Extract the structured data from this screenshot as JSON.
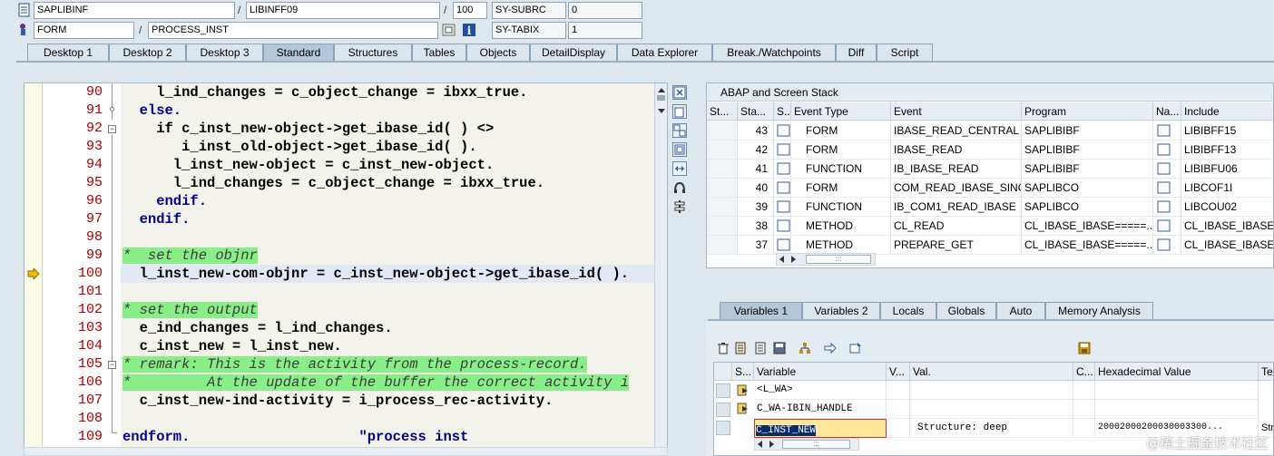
{
  "header": {
    "row1": {
      "program": "SAPLIBINF",
      "include": "LIBINFF09",
      "line": "100",
      "sysfield_name": "SY-SUBRC",
      "sysfield_value": "0"
    },
    "row2": {
      "event_type": "FORM",
      "event_name": "PROCESS_INST",
      "sysfield_name": "SY-TABIX",
      "sysfield_value": "1"
    }
  },
  "tabs": [
    "Desktop 1",
    "Desktop 2",
    "Desktop 3",
    "Standard",
    "Structures",
    "Tables",
    "Objects",
    "DetailDisplay",
    "Data Explorer",
    "Break./Watchpoints",
    "Diff",
    "Script"
  ],
  "active_tab": "Standard",
  "code": {
    "lines": [
      {
        "num": "90",
        "text": "    l_ind_changes = c_object_change = ibxx_true."
      },
      {
        "num": "91",
        "text": "  else."
      },
      {
        "num": "92",
        "text": "    if c_inst_new-object->get_ibase_id( ) <>"
      },
      {
        "num": "93",
        "text": "       i_inst_old-object->get_ibase_id( )."
      },
      {
        "num": "94",
        "text": "      l_inst_new-object = c_inst_new-object."
      },
      {
        "num": "95",
        "text": "      l_ind_changes = c_object_change = ibxx_true."
      },
      {
        "num": "96",
        "text": "    endif."
      },
      {
        "num": "97",
        "text": "  endif."
      },
      {
        "num": "98",
        "text": ""
      },
      {
        "num": "99",
        "text": "*  set the objnr"
      },
      {
        "num": "100",
        "text": "  l_inst_new-com-objnr = c_inst_new-object->get_ibase_id( )."
      },
      {
        "num": "101",
        "text": ""
      },
      {
        "num": "102",
        "text": "* set the output"
      },
      {
        "num": "103",
        "text": "  e_ind_changes = l_ind_changes."
      },
      {
        "num": "104",
        "text": "  c_inst_new = l_inst_new."
      },
      {
        "num": "105",
        "text": "* remark: This is the activity from the process-record."
      },
      {
        "num": "106",
        "text": "*         At the update of the buffer the correct activity i"
      },
      {
        "num": "107",
        "text": "  c_inst_new-ind-activity = i_process_rec-activity."
      },
      {
        "num": "108",
        "text": ""
      },
      {
        "num": "109",
        "text": "endform.                    \"process inst"
      }
    ],
    "current_line": "100"
  },
  "stack": {
    "title": "ABAP and Screen Stack",
    "columns": [
      "St...",
      "Sta...",
      "S...",
      "Event Type",
      "Event",
      "Program",
      "Na...",
      "Include"
    ],
    "rows": [
      {
        "sta": "43",
        "type": "FORM",
        "event": "IBASE_READ_CENTRAL",
        "program": "SAPLIBIBF",
        "include": "LIBIBFF15"
      },
      {
        "sta": "42",
        "type": "FORM",
        "event": "IBASE_READ",
        "program": "SAPLIBIBF",
        "include": "LIBIBFF13"
      },
      {
        "sta": "41",
        "type": "FUNCTION",
        "event": "IB_IBASE_READ",
        "program": "SAPLIBIBF",
        "include": "LIBIBFU06"
      },
      {
        "sta": "40",
        "type": "FORM",
        "event": "COM_READ_IBASE_SING...",
        "program": "SAPLIBCO",
        "include": "LIBCOF1I"
      },
      {
        "sta": "39",
        "type": "FUNCTION",
        "event": "IB_COM1_READ_IBASE",
        "program": "SAPLIBCO",
        "include": "LIBCOU02"
      },
      {
        "sta": "38",
        "type": "METHOD",
        "event": "CL_READ",
        "program": "CL_IBASE_IBASE=====...",
        "include": "CL_IBASE_IBASE="
      },
      {
        "sta": "37",
        "type": "METHOD",
        "event": "PREPARE_GET",
        "program": "CL_IBASE_IBASE=====...",
        "include": "CL_IBASE_IBASE="
      }
    ]
  },
  "vars": {
    "tabs": [
      "Variables 1",
      "Variables 2",
      "Locals",
      "Globals",
      "Auto",
      "Memory Analysis"
    ],
    "active_tab": "Variables 1",
    "columns": [
      "S...",
      "Variable",
      "V...",
      "Val.",
      "C...",
      "Hexadecimal Value",
      "Te"
    ],
    "rows": [
      {
        "variable": "<L_WA>",
        "value": "",
        "hex": "",
        "te": ""
      },
      {
        "variable": "C_WA-IBIN_HANDLE",
        "value": "",
        "hex": "",
        "te": ""
      },
      {
        "variable": "C_INST_NEW",
        "value": "Structure: deep",
        "hex": "20002000200030003300...",
        "te": "Str"
      }
    ]
  },
  "watermark": "@稀土掘金技术社区"
}
